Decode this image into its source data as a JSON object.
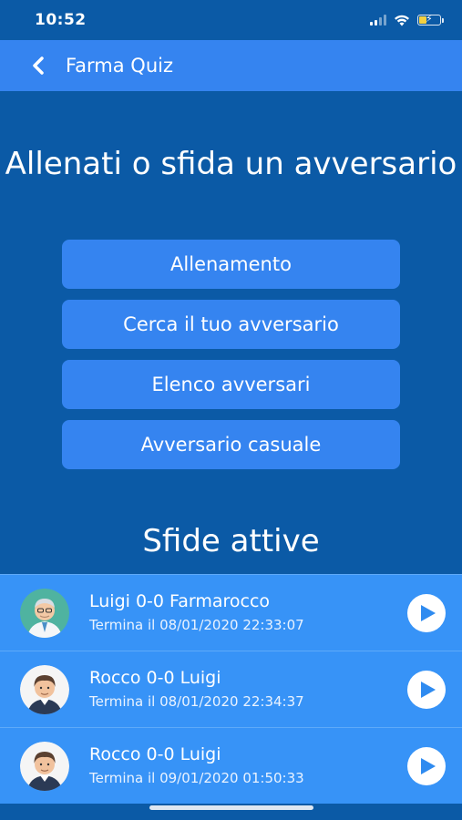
{
  "status_bar": {
    "time": "10:52"
  },
  "nav": {
    "title": "Farma Quiz"
  },
  "hero": {
    "title": "Allenati o sfida un avversario"
  },
  "menu": [
    {
      "label": "Allenamento"
    },
    {
      "label": "Cerca il tuo avversario"
    },
    {
      "label": "Elenco avversari"
    },
    {
      "label": "Avversario casuale"
    }
  ],
  "active_section": {
    "title": "Sfide attive"
  },
  "challenges": [
    {
      "title": "Luigi 0-0 Farmarocco",
      "ends": "Termina il 08/01/2020 22:33:07",
      "avatar": "pharmacist-avatar"
    },
    {
      "title": "Rocco 0-0 Luigi",
      "ends": "Termina il 08/01/2020 22:34:37",
      "avatar": "user-avatar"
    },
    {
      "title": "Rocco 0-0 Luigi",
      "ends": "Termina il 09/01/2020 01:50:33",
      "avatar": "user-avatar"
    }
  ],
  "colors": {
    "background": "#0b5aa6",
    "accent": "#3584f0",
    "list_row": "#3793f7"
  }
}
